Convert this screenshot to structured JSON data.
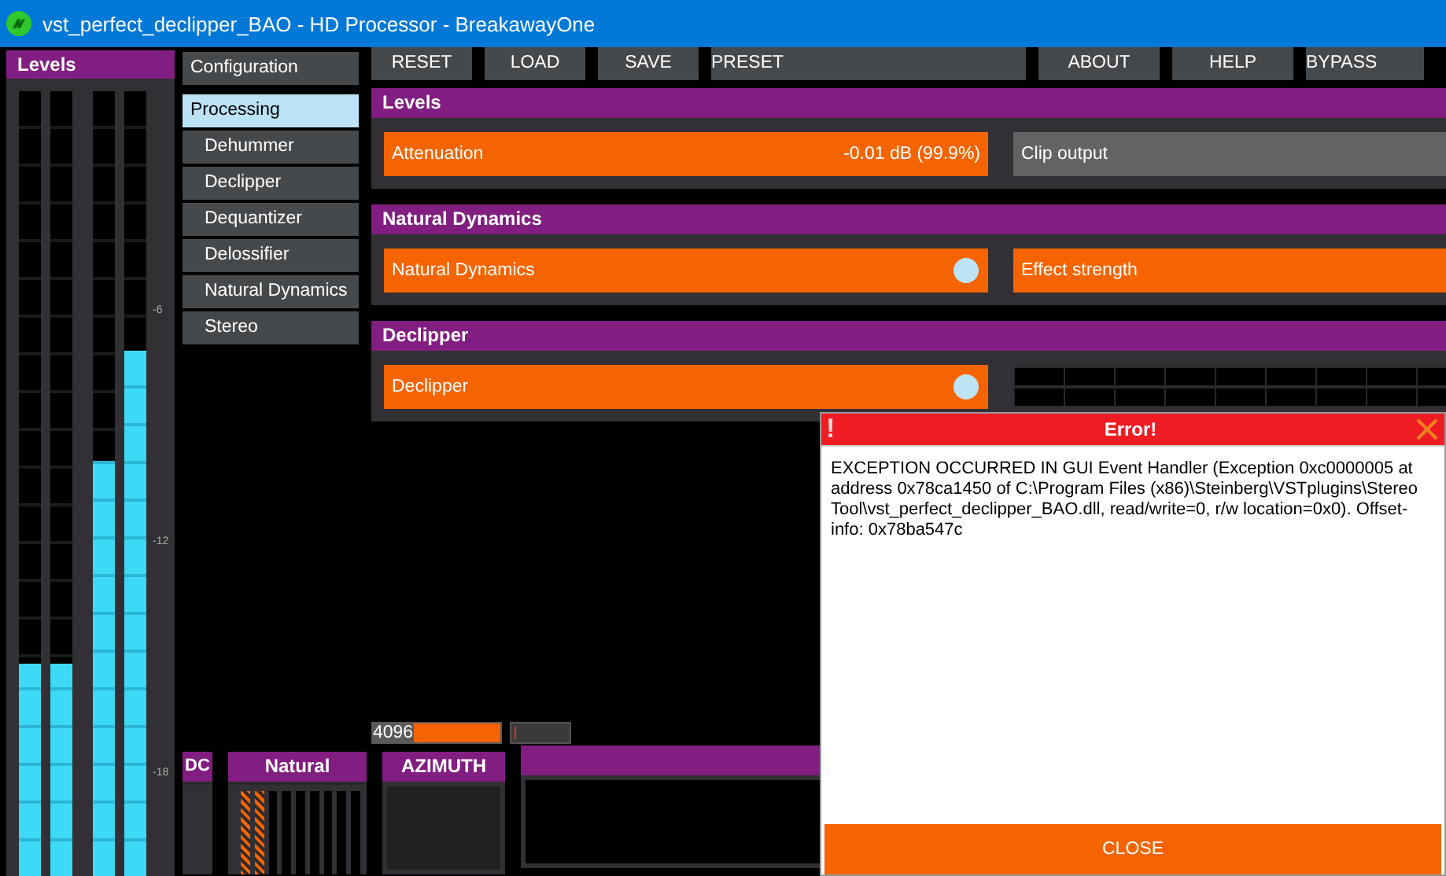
{
  "window": {
    "title": "vst_perfect_declipper_BAO - HD Processor - BreakawayOne"
  },
  "levels_panel": {
    "title": "Levels",
    "meters": [
      {
        "level": 0.27
      },
      {
        "level": 0.27
      },
      {
        "level": 0.53
      },
      {
        "level": 0.67
      }
    ],
    "scale": [
      "-6",
      "-12",
      "-18"
    ]
  },
  "nav": [
    {
      "label": "Configuration",
      "kind": "top",
      "selected": false
    },
    {
      "label": "Processing",
      "kind": "top",
      "selected": true
    },
    {
      "label": "Dehummer",
      "kind": "sub",
      "selected": false
    },
    {
      "label": "Declipper",
      "kind": "sub",
      "selected": false
    },
    {
      "label": "Dequantizer",
      "kind": "sub",
      "selected": false
    },
    {
      "label": "Delossifier",
      "kind": "sub",
      "selected": false
    },
    {
      "label": "Natural Dynamics",
      "kind": "sub",
      "selected": false
    },
    {
      "label": "Stereo",
      "kind": "sub",
      "selected": false
    }
  ],
  "toolbar": [
    {
      "label": "RESET",
      "kind": "button"
    },
    {
      "label": "LOAD",
      "kind": "button"
    },
    {
      "label": "SAVE",
      "kind": "button"
    },
    {
      "label": "PRESET",
      "kind": "field"
    },
    {
      "label": "ABOUT",
      "kind": "button"
    },
    {
      "label": "HELP",
      "kind": "button"
    },
    {
      "label": "BYPASS",
      "kind": "toggle"
    }
  ],
  "sections": [
    {
      "title": "Levels",
      "controls": [
        {
          "kind": "slider",
          "label": "Attenuation",
          "value": "-0.01 dB (99.9%)",
          "level": 1
        },
        {
          "kind": "switch",
          "label": "Clip output",
          "on": false
        }
      ]
    },
    {
      "title": "Natural Dynamics",
      "controls": [
        {
          "kind": "switch",
          "label": "Natural Dynamics",
          "on": true
        },
        {
          "kind": "slider",
          "label": "Effect strength",
          "level": 1
        }
      ]
    },
    {
      "title": "Declipper",
      "controls": [
        {
          "kind": "switch",
          "label": "Declipper",
          "on": true
        },
        {
          "kind": "meter-grid"
        }
      ]
    }
  ],
  "buffer": {
    "value": "4096",
    "level": 1
  },
  "small_slider": {
    "level": 0.05
  },
  "bottom_panels": [
    {
      "title": "DC",
      "kind": "meters"
    },
    {
      "title": "Natural",
      "kind": "meters"
    },
    {
      "title": "AZIMUTH",
      "kind": "scope"
    },
    {
      "kind": "graph"
    }
  ],
  "error_dialog": {
    "icon": "!",
    "title": "Error!",
    "message": "EXCEPTION OCCURRED IN GUI Event Handler (Exception 0xc0000005 at address 0x78ca1450 of C:\\Program Files (x86)\\Steinberg\\VSTplugins\\Stereo Tool\\vst_perfect_declipper_BAO.dll, read/write=0, r/w location=0x0). Offset-info: 0x78ba547c",
    "button": "CLOSE"
  }
}
